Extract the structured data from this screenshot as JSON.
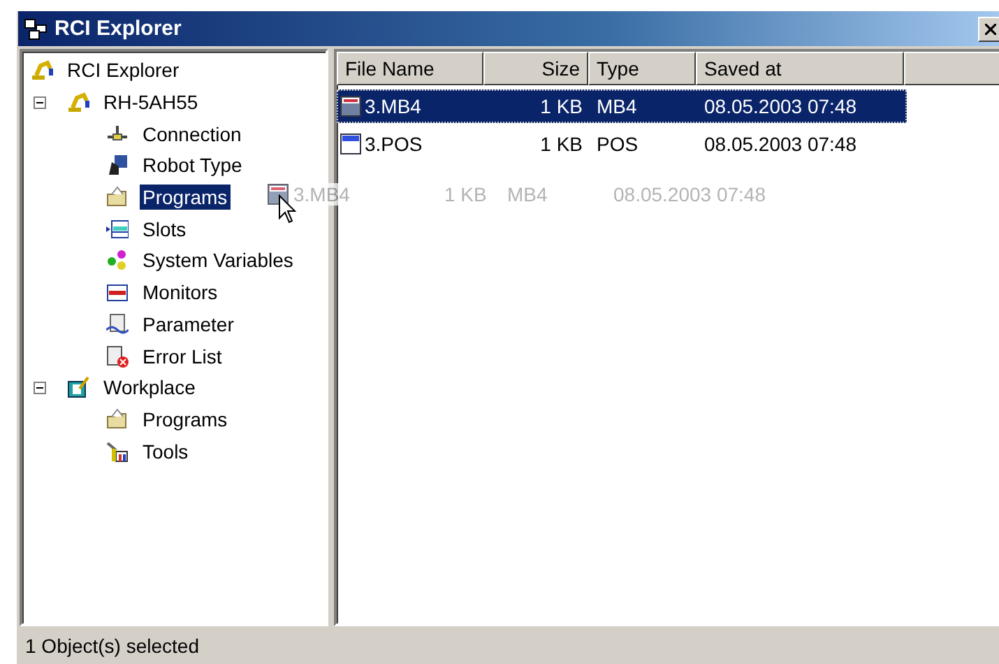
{
  "window": {
    "title": "RCI Explorer"
  },
  "tree": [
    {
      "label": "RCI Explorer",
      "kind": "robot",
      "selected": false,
      "children": [
        {
          "label": "RH-5AH55",
          "kind": "robot",
          "selected": false,
          "expanded": true,
          "children": [
            {
              "label": "Connection",
              "kind": "connection",
              "selected": false
            },
            {
              "label": "Robot Type",
              "kind": "robottype",
              "selected": false
            },
            {
              "label": "Programs",
              "kind": "folder",
              "selected": true
            },
            {
              "label": "Slots",
              "kind": "slots",
              "selected": false
            },
            {
              "label": "System Variables",
              "kind": "sysvars",
              "selected": false
            },
            {
              "label": "Monitors",
              "kind": "monitors",
              "selected": false
            },
            {
              "label": "Parameter",
              "kind": "parameter",
              "selected": false
            },
            {
              "label": "Error List",
              "kind": "errorlist",
              "selected": false
            }
          ]
        },
        {
          "label": "Workplace",
          "kind": "workplace",
          "selected": false,
          "expanded": true,
          "children": [
            {
              "label": "Programs",
              "kind": "folder",
              "selected": false
            },
            {
              "label": "Tools",
              "kind": "tools",
              "selected": false
            }
          ]
        }
      ]
    }
  ],
  "file_list": {
    "columns": [
      "File Name",
      "Size",
      "Type",
      "Saved at"
    ],
    "rows": [
      {
        "name": "3.MB4",
        "kind": "prg",
        "size": "1 KB",
        "type": "MB4",
        "saved_at": "08.05.2003 07:48",
        "selected": true
      },
      {
        "name": "3.POS",
        "kind": "pos",
        "size": "1 KB",
        "type": "POS",
        "saved_at": "08.05.2003 07:48",
        "selected": false
      }
    ]
  },
  "drag_ghost": {
    "name": "3.MB4",
    "kind": "prg",
    "size": "1 KB",
    "type": "MB4",
    "saved_at": "08.05.2003 07:48"
  },
  "status_bar": {
    "text": "1 Object(s) selected"
  }
}
